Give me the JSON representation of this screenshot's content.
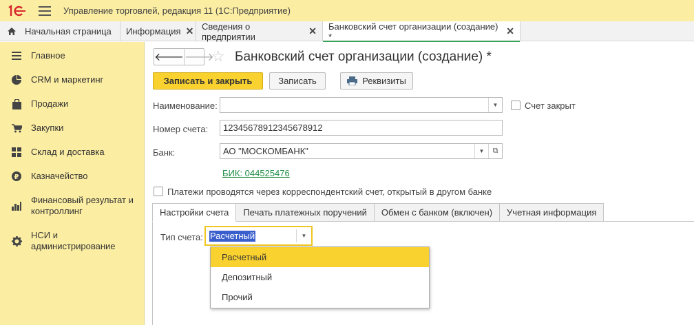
{
  "app": {
    "title": "Управление торговлей, редакция 11  (1С:Предприятие)",
    "accent_color": "#fad22f",
    "panel_color": "#fbeda2"
  },
  "tabs": [
    {
      "label": "Начальная страница",
      "icon": "home-icon",
      "closable": false
    },
    {
      "label": "Информация",
      "closable": true
    },
    {
      "label": "Сведения о предприятии",
      "closable": true
    },
    {
      "label": "Банковский счет организации (создание) *",
      "closable": true,
      "active": true
    }
  ],
  "sidebar": {
    "items": [
      {
        "label": "Главное",
        "icon": "list-icon"
      },
      {
        "label": "CRM и маркетинг",
        "icon": "pie-chart-icon"
      },
      {
        "label": "Продажи",
        "icon": "shopping-bag-icon"
      },
      {
        "label": "Закупки",
        "icon": "cart-icon"
      },
      {
        "label": "Склад и доставка",
        "icon": "grid-icon"
      },
      {
        "label": "Казначейство",
        "icon": "ruble-icon"
      },
      {
        "label": "Финансовый результат и контроллинг",
        "icon": "bar-chart-icon"
      },
      {
        "label": "НСИ и администрирование",
        "icon": "gear-icon"
      }
    ]
  },
  "form": {
    "title": "Банковский счет организации (создание) *",
    "buttons": {
      "save_close": "Записать и закрыть",
      "save": "Записать",
      "requisites": "Реквизиты"
    },
    "name_label": "Наименование:",
    "name_value": "",
    "closed_label": "Счет закрыт",
    "closed_checked": false,
    "account_label": "Номер счета:",
    "account_value": "12345678912345678912",
    "bank_label": "Банк:",
    "bank_value": "АО \"МОСКОМБАНК\"",
    "bik_link": "БИК: 044525476",
    "corr_label": "Платежи проводятся через корреспондентский счет, открытый в другом банке",
    "corr_checked": false
  },
  "inner_tabs": [
    {
      "label": "Настройки счета",
      "active": true
    },
    {
      "label": "Печать платежных поручений"
    },
    {
      "label": "Обмен с банком (включен)"
    },
    {
      "label": "Учетная информация"
    }
  ],
  "account_type": {
    "label": "Тип счета:",
    "value": "Расчетный",
    "options": [
      "Расчетный",
      "Депозитный",
      "Прочий"
    ],
    "highlighted": "Расчетный"
  }
}
